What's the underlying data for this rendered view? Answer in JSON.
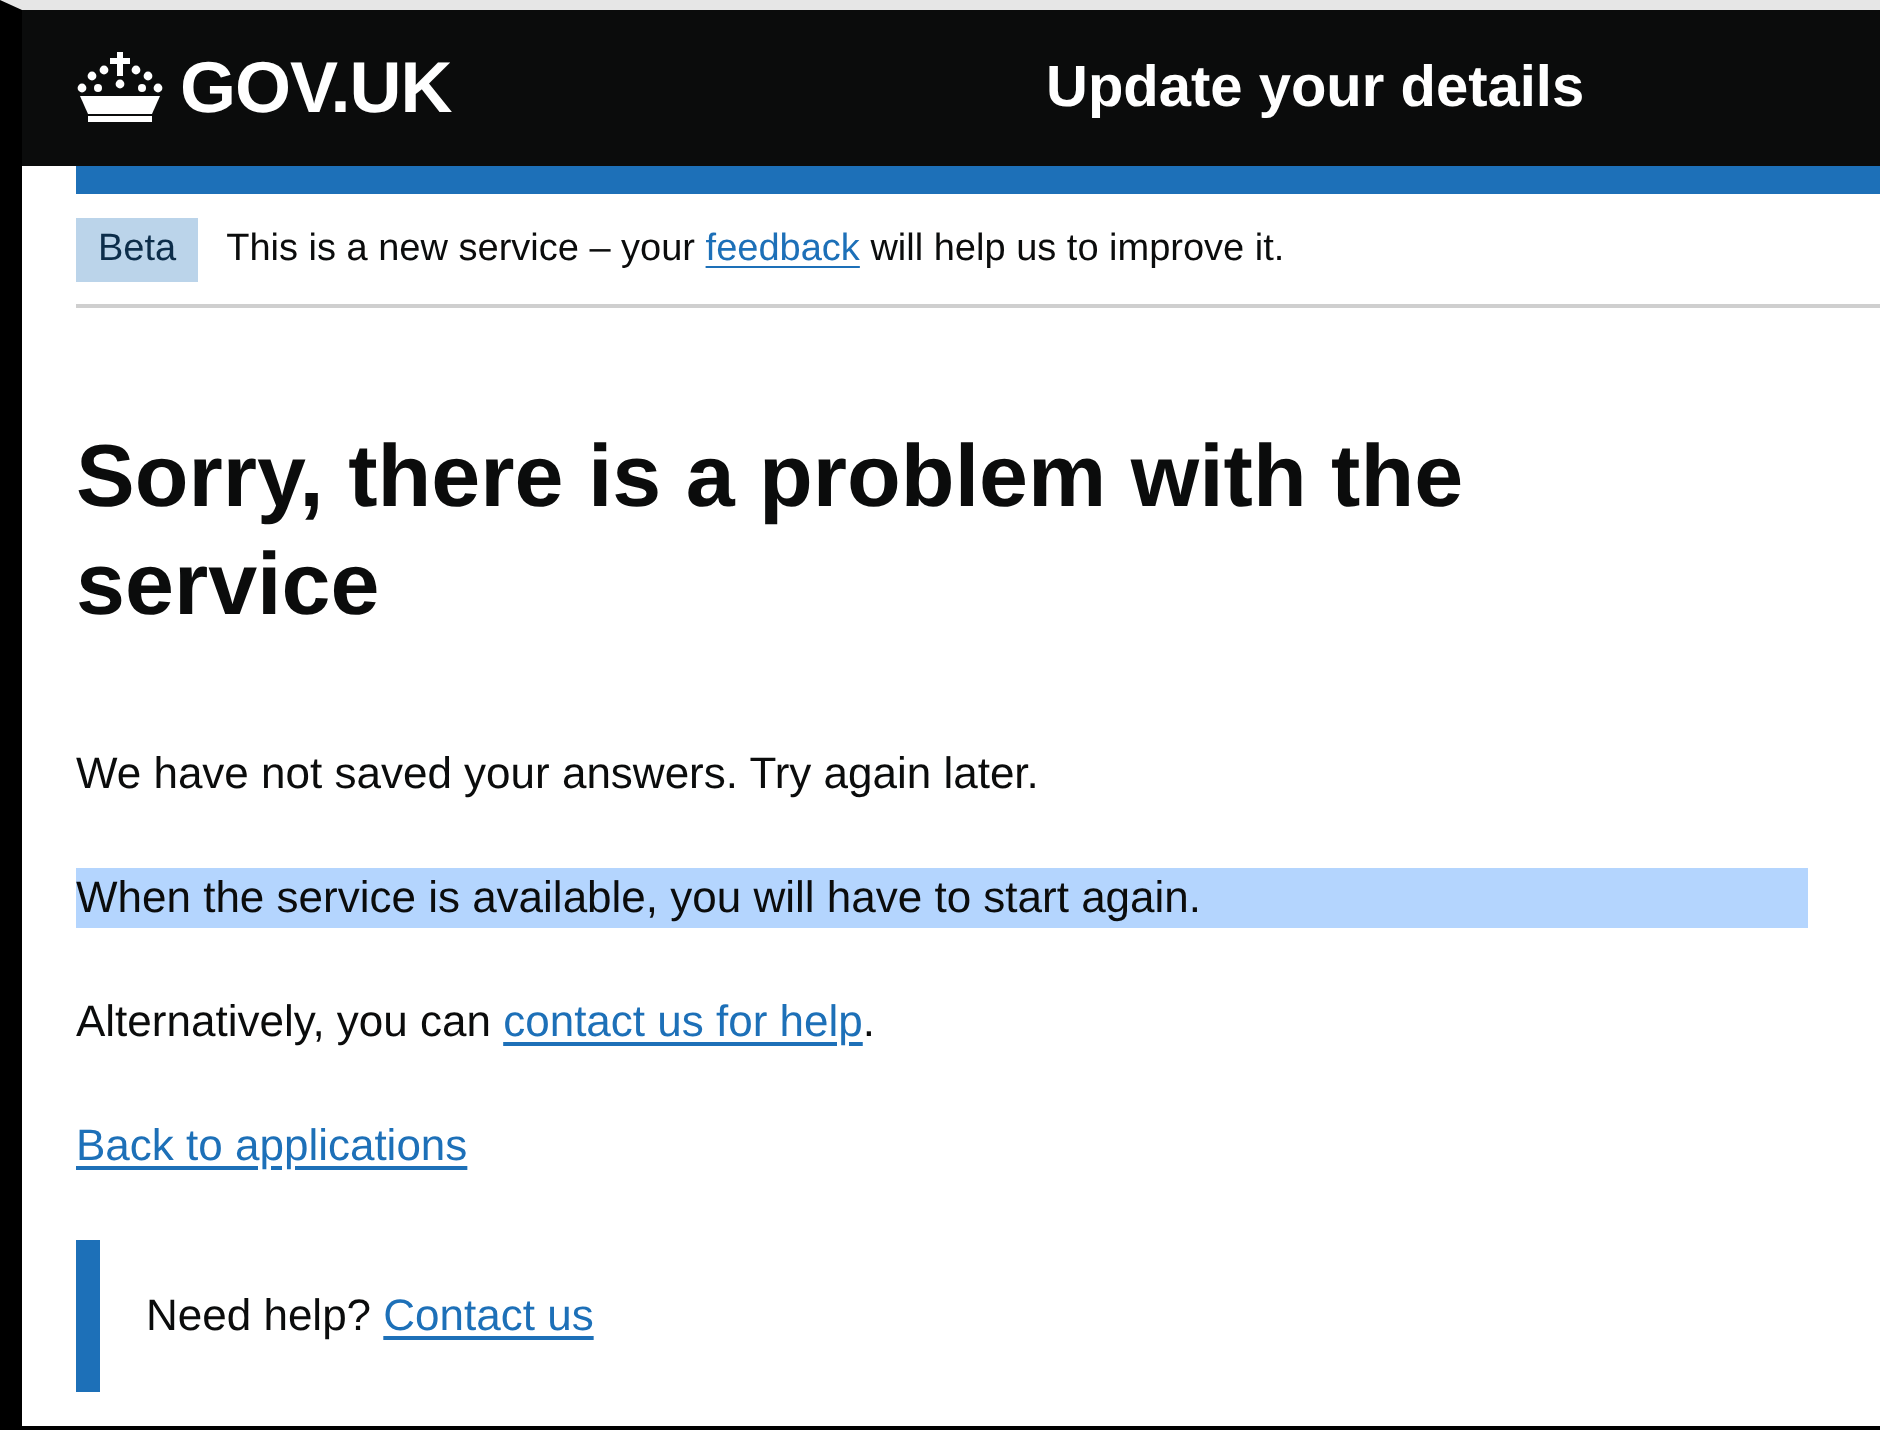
{
  "header": {
    "logo": "GOV.UK",
    "service_name": "Update your details"
  },
  "phase_banner": {
    "tag": "Beta",
    "text_before": "This is a new service – your",
    "link": "feedback",
    "text_after": "will help us to improve it."
  },
  "heading": "Sorry, there is a problem with the service",
  "paragraphs": [
    {
      "kind": "text",
      "text": "We have not saved your answers. Try again later.",
      "highlighted": false
    },
    {
      "kind": "text",
      "text": "When the service is available, you will have to start again.",
      "highlighted": true
    },
    {
      "kind": "with_link",
      "text": "Alternatively, you can",
      "link": "contact us for help",
      "after": ".",
      "highlighted": false
    },
    {
      "kind": "link",
      "text": "Back to applications",
      "highlighted": false
    }
  ],
  "inset": {
    "text": "Need help?",
    "link": "Contact us"
  }
}
